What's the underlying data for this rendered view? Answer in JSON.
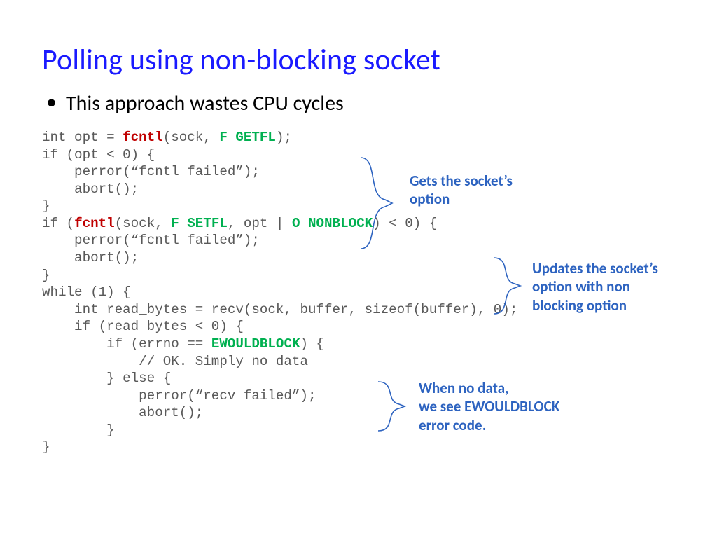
{
  "title": "Polling using non-blocking socket",
  "bullet1": "This approach wastes CPU cycles",
  "code": {
    "l1a": "int opt = ",
    "l1b": "fcntl",
    "l1c": "(sock, ",
    "l1d": "F_GETFL",
    "l1e": ");",
    "l2": "if (opt < 0) {",
    "l3": "    perror(“fcntl failed”);",
    "l4": "    abort();",
    "l5": "}",
    "l6a": "if (",
    "l6b": "fcntl",
    "l6c": "(sock, ",
    "l6d": "F_SETFL",
    "l6e": ", opt | ",
    "l6f": "O_NONBLOCK",
    "l6g": ") < 0) {",
    "l7": "    perror(“fcntl failed”);",
    "l8": "    abort();",
    "l9": "}",
    "l10": "while (1) {",
    "l11": "    int read_bytes = recv(sock, buffer, sizeof(buffer), 0);",
    "l12": "    if (read_bytes < 0) {",
    "l13a": "        if (errno == ",
    "l13b": "EWOULDBLOCK",
    "l13c": ") {",
    "l14": "            // OK. Simply no data",
    "l15": "        } else {",
    "l16": "            perror(“recv failed”);",
    "l17": "            abort();",
    "l18": "        }",
    "l19": "}"
  },
  "annot1_l1": "Gets the socket’s",
  "annot1_l2": "option",
  "annot2_l1": "Updates the socket’s",
  "annot2_l2": "option with non",
  "annot2_l3": "blocking option",
  "annot3_l1": "When no data,",
  "annot3_l2": "we see EWOULDBLOCK",
  "annot3_l3": "error code."
}
